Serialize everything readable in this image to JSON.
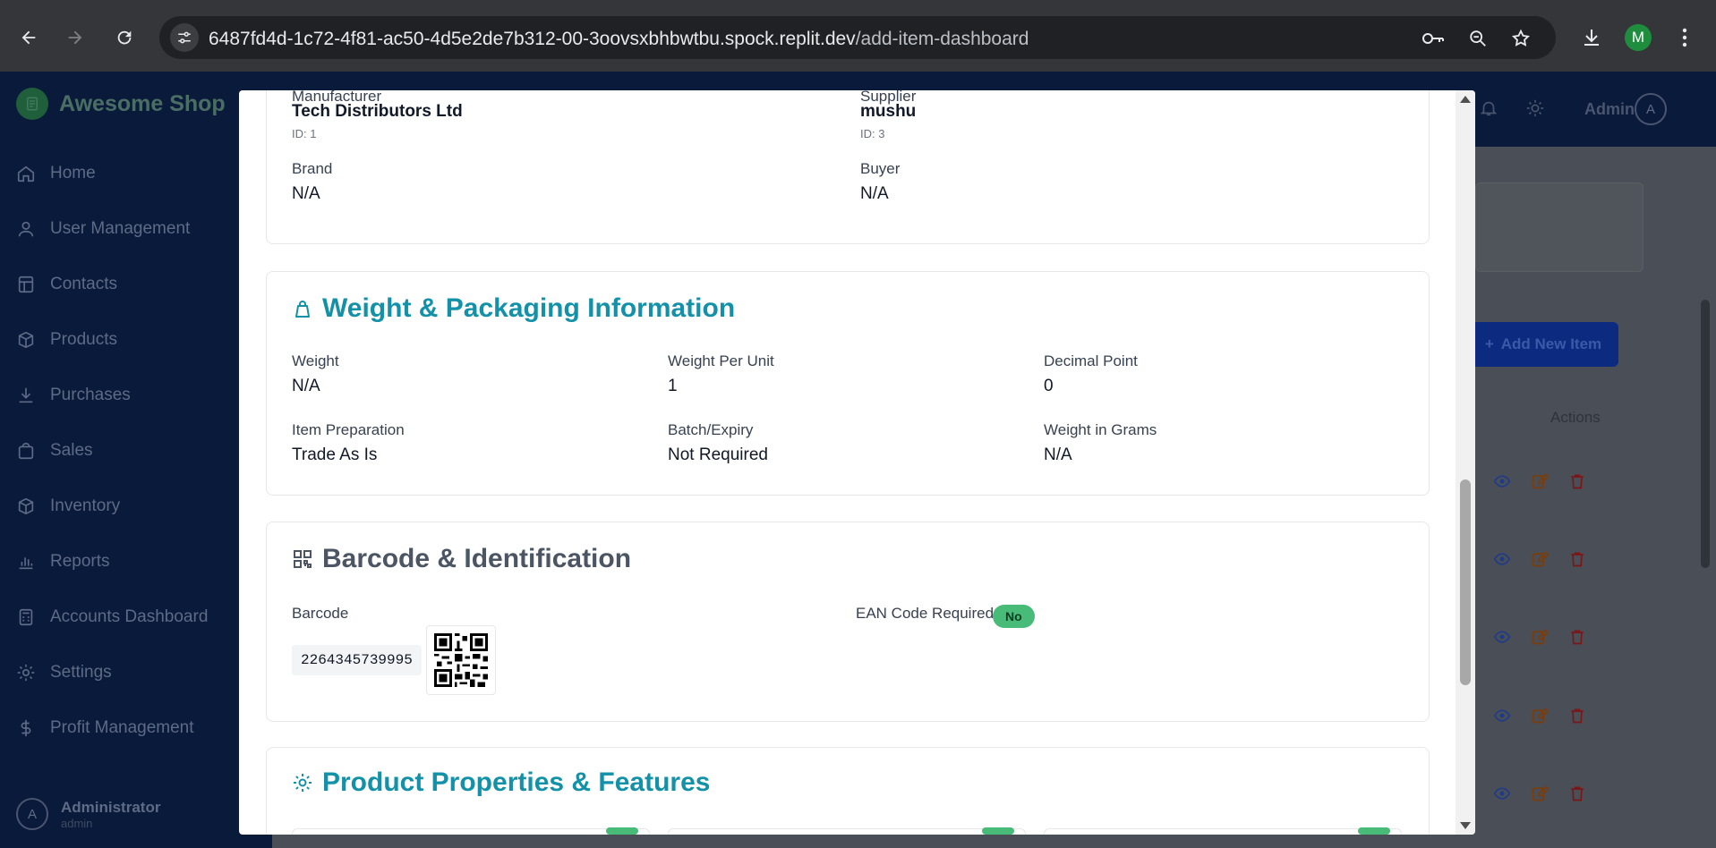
{
  "browser": {
    "url_host": "6487fd4d-1c72-4f81-ac50-4d5e2de7b312-00-3oovsxbhbwtbu.spock.replit.dev",
    "url_path": "/add-item-dashboard",
    "profile_initial": "M"
  },
  "app": {
    "brand": "Awesome Shop",
    "admin_label": "Admin",
    "admin_initial": "A",
    "sidebar": [
      {
        "label": "Home",
        "icon": "home-icon"
      },
      {
        "label": "User Management",
        "icon": "user-icon"
      },
      {
        "label": "Contacts",
        "icon": "contacts-icon"
      },
      {
        "label": "Products",
        "icon": "box-icon"
      },
      {
        "label": "Purchases",
        "icon": "download-icon"
      },
      {
        "label": "Sales",
        "icon": "shopping-bag-icon"
      },
      {
        "label": "Inventory",
        "icon": "box-icon"
      },
      {
        "label": "Reports",
        "icon": "bar-chart-icon"
      },
      {
        "label": "Accounts Dashboard",
        "icon": "calculator-icon"
      },
      {
        "label": "Settings",
        "icon": "gear-icon"
      },
      {
        "label": "Profit Management",
        "icon": "dollar-icon"
      }
    ],
    "user": {
      "name": "Administrator",
      "role": "admin",
      "initial": "A"
    },
    "add_new_item": "Add New Item",
    "actions_header": "Actions"
  },
  "modal": {
    "supplier_section": {
      "manufacturer_label": "Manufacturer",
      "manufacturer_value": "Tech Distributors Ltd",
      "manufacturer_id": "ID: 1",
      "supplier_label": "Supplier",
      "supplier_value": "mushu",
      "supplier_id": "ID: 3",
      "brand_label": "Brand",
      "brand_value": "N/A",
      "buyer_label": "Buyer",
      "buyer_value": "N/A"
    },
    "weight_section": {
      "title": "Weight & Packaging Information",
      "fields": [
        {
          "label": "Weight",
          "value": "N/A"
        },
        {
          "label": "Weight Per Unit",
          "value": "1"
        },
        {
          "label": "Decimal Point",
          "value": "0"
        },
        {
          "label": "Item Preparation",
          "value": "Trade As Is"
        },
        {
          "label": "Batch/Expiry",
          "value": "Not Required"
        },
        {
          "label": "Weight in Grams",
          "value": "N/A"
        }
      ]
    },
    "barcode_section": {
      "title": "Barcode & Identification",
      "barcode_label": "Barcode",
      "barcode_value": "2264345739995",
      "ean_label": "EAN Code Required",
      "ean_value": "No"
    },
    "properties_section": {
      "title": "Product Properties & Features"
    }
  },
  "colors": {
    "teal_title": "#1391a8",
    "gray_title": "#4b5563",
    "badge_green": "#48bb78"
  }
}
